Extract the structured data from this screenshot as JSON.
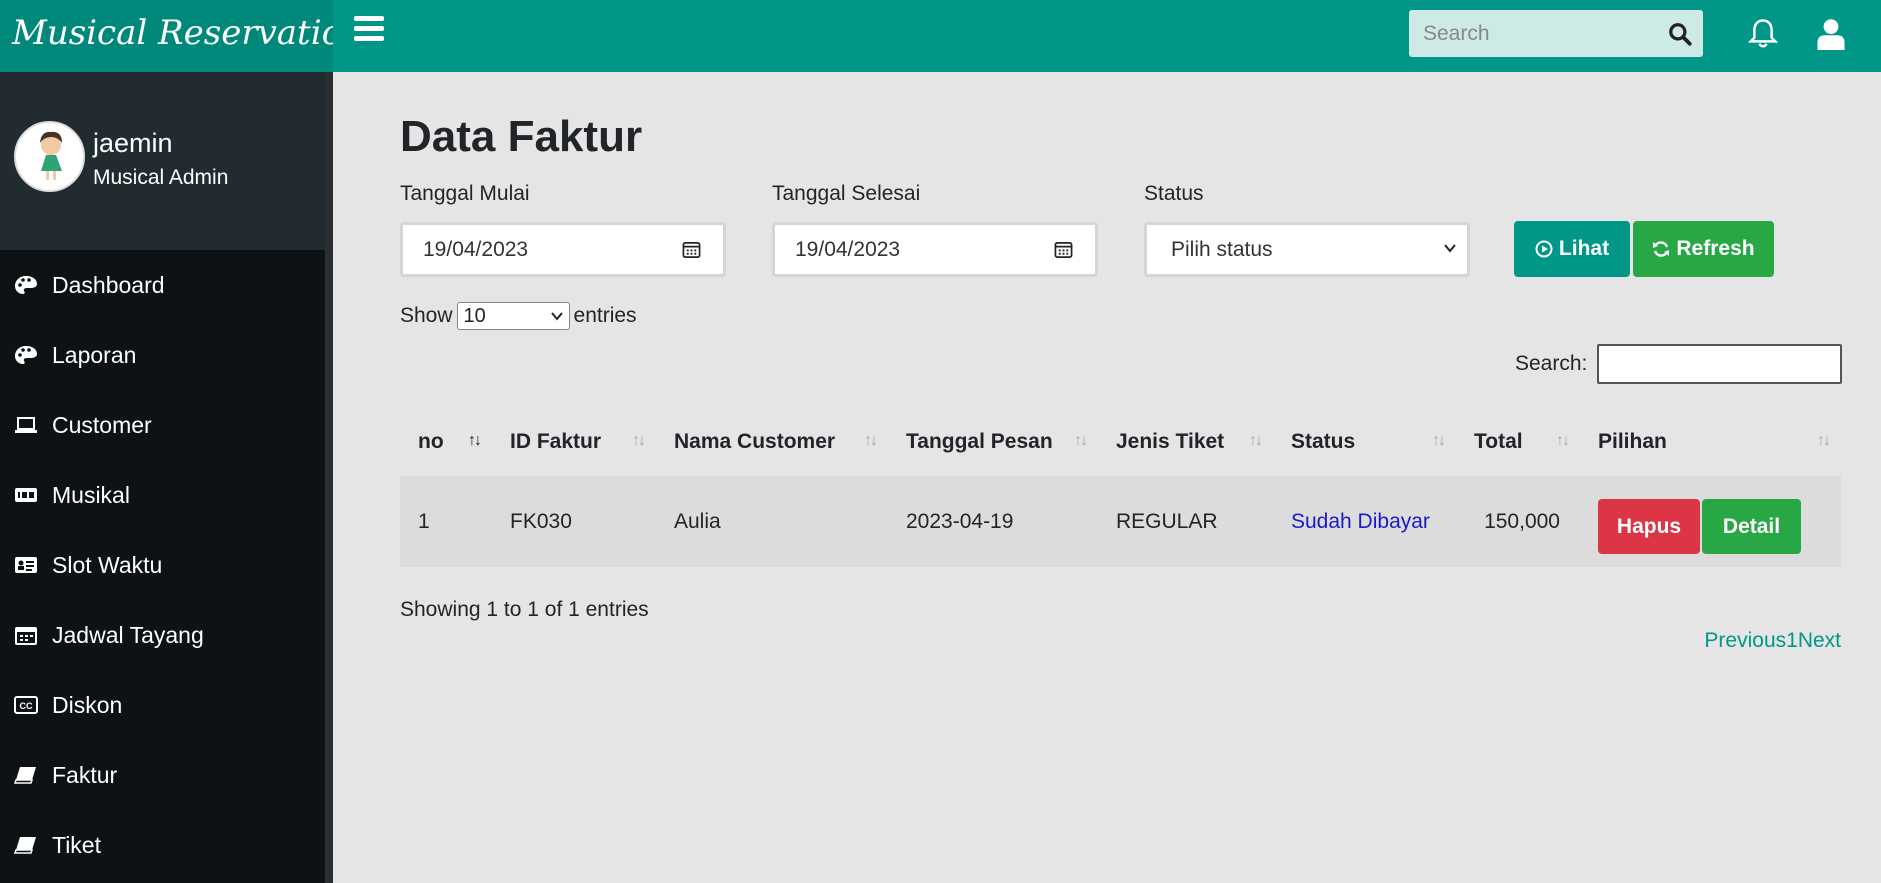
{
  "app": {
    "brand": "Musical Reservation"
  },
  "topbar": {
    "search_placeholder": "Search"
  },
  "profile": {
    "name": "jaemin",
    "role": "Musical Admin"
  },
  "sidebar": {
    "items": [
      {
        "label": "Dashboard",
        "icon": "palette-icon"
      },
      {
        "label": "Laporan",
        "icon": "palette-icon"
      },
      {
        "label": "Customer",
        "icon": "laptop-icon"
      },
      {
        "label": "Musikal",
        "icon": "imdb-icon"
      },
      {
        "label": "Slot Waktu",
        "icon": "id-card-icon"
      },
      {
        "label": "Jadwal Tayang",
        "icon": "calendar-icon"
      },
      {
        "label": "Diskon",
        "icon": "closed-captioning-icon"
      },
      {
        "label": "Faktur",
        "icon": "book-icon"
      },
      {
        "label": "Tiket",
        "icon": "book-icon"
      }
    ]
  },
  "page": {
    "title": "Data Faktur"
  },
  "filters": {
    "start_label": "Tanggal Mulai",
    "start_value": "19/04/2023",
    "end_label": "Tanggal Selesai",
    "end_value": "19/04/2023",
    "status_label": "Status",
    "status_value": "Pilih status",
    "lihat_label": "Lihat",
    "refresh_label": "Refresh"
  },
  "datatable": {
    "show_label": "Show",
    "entries_value": "10",
    "entries_label": "entries",
    "search_label": "Search:",
    "columns": [
      "no",
      "ID Faktur",
      "Nama Customer",
      "Tanggal Pesan",
      "Jenis Tiket",
      "Status",
      "Total",
      "Pilihan"
    ],
    "rows": [
      {
        "no": "1",
        "id": "FK030",
        "customer": "Aulia",
        "date": "2023-04-19",
        "ticket": "REGULAR",
        "status": "Sudah Dibayar",
        "total": "150,000",
        "hapus": "Hapus",
        "detail": "Detail"
      }
    ],
    "info": "Showing 1 to 1 of 1 entries",
    "pager": {
      "previous": "Previous",
      "page": "1",
      "next": "Next"
    }
  },
  "colors": {
    "primary": "#009688",
    "danger": "#dc3545",
    "success": "#28a745",
    "sidebar": "#0d1214"
  }
}
